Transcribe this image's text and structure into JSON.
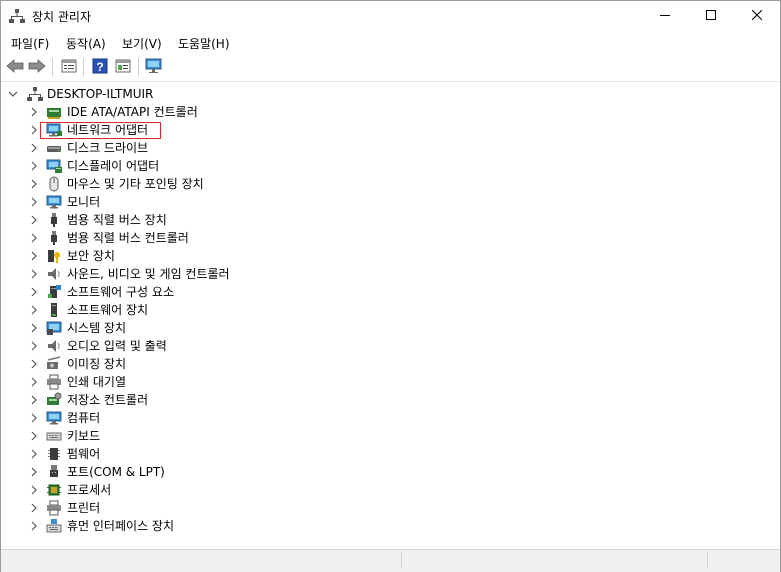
{
  "window": {
    "title": "장치 관리자",
    "buttons": {
      "minimize": "minimize-icon",
      "maximize": "maximize-icon",
      "close": "close-icon"
    }
  },
  "menu": [
    {
      "label": "파일(F)"
    },
    {
      "label": "동작(A)"
    },
    {
      "label": "보기(V)"
    },
    {
      "label": "도움말(H)"
    }
  ],
  "toolbar": {
    "items": [
      "back-arrow-icon",
      "forward-arrow-icon",
      "properties-list-icon",
      "help-icon",
      "view-panel-icon",
      "monitor-scan-icon"
    ]
  },
  "tree": {
    "root": {
      "label": "DESKTOP-ILTMUIR",
      "icon": "computer-tree-icon",
      "expanded": true
    },
    "items": [
      {
        "label": "IDE ATA/ATAPI 컨트롤러",
        "icon": "ide-controller-icon"
      },
      {
        "label": "네트워크 어댑터",
        "icon": "network-adapter-icon",
        "highlighted": true
      },
      {
        "label": "디스크 드라이브",
        "icon": "disk-drive-icon"
      },
      {
        "label": "디스플레이 어댑터",
        "icon": "display-adapter-icon"
      },
      {
        "label": "마우스 및 기타 포인팅 장치",
        "icon": "mouse-icon"
      },
      {
        "label": "모니터",
        "icon": "monitor-icon"
      },
      {
        "label": "범용 직렬 버스 장치",
        "icon": "usb-icon"
      },
      {
        "label": "범용 직렬 버스 컨트롤러",
        "icon": "usb-icon"
      },
      {
        "label": "보안 장치",
        "icon": "security-key-icon"
      },
      {
        "label": "사운드, 비디오 및 게임 컨트롤러",
        "icon": "speaker-icon"
      },
      {
        "label": "소프트웨어 구성 요소",
        "icon": "software-component-icon"
      },
      {
        "label": "소프트웨어 장치",
        "icon": "software-device-icon"
      },
      {
        "label": "시스템 장치",
        "icon": "system-device-icon"
      },
      {
        "label": "오디오 입력 및 출력",
        "icon": "speaker-icon"
      },
      {
        "label": "이미징 장치",
        "icon": "camera-icon"
      },
      {
        "label": "인쇄 대기열",
        "icon": "printer-icon"
      },
      {
        "label": "저장소 컨트롤러",
        "icon": "storage-controller-icon"
      },
      {
        "label": "컴퓨터",
        "icon": "computer-monitor-icon"
      },
      {
        "label": "키보드",
        "icon": "keyboard-icon"
      },
      {
        "label": "펌웨어",
        "icon": "firmware-chip-icon"
      },
      {
        "label": "포트(COM & LPT)",
        "icon": "port-icon"
      },
      {
        "label": "프로세서",
        "icon": "processor-icon"
      },
      {
        "label": "프린터",
        "icon": "printer-icon"
      },
      {
        "label": "휴먼 인터페이스 장치",
        "icon": "hid-keyboard-icon"
      }
    ]
  },
  "colors": {
    "highlight_border": "#e0262b",
    "icon_blue": "#2e86c8",
    "icon_dark": "#3c3c3c"
  }
}
